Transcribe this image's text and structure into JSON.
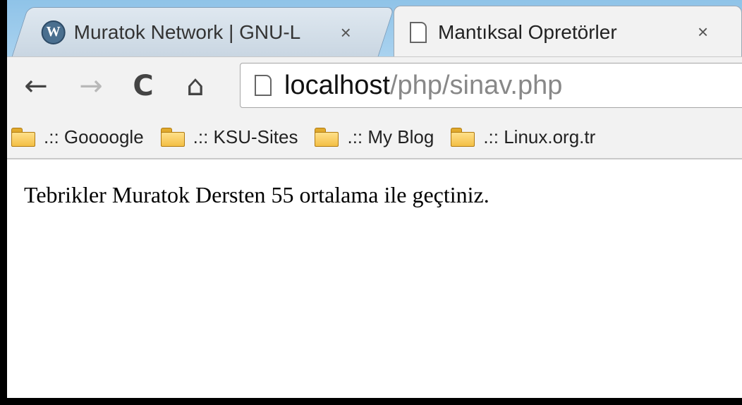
{
  "tabs": [
    {
      "title": "Muratok Network | GNU-L",
      "close": "×",
      "icon": "wordpress-icon",
      "active": false
    },
    {
      "title": "Mantıksal Opretörler",
      "close": "×",
      "icon": "page-icon",
      "active": true
    }
  ],
  "toolbar": {
    "back": "←",
    "forward": "→",
    "reload": "C",
    "home": "⌂",
    "url_host": "localhost",
    "url_path": "/php/sinav.php"
  },
  "bookmarks": [
    {
      "label": ".:: Goooogle",
      "icon": "folder-icon"
    },
    {
      "label": ".:: KSU-Sites",
      "icon": "folder-icon"
    },
    {
      "label": ".:: My Blog",
      "icon": "folder-icon"
    },
    {
      "label": ".:: Linux.org.tr",
      "icon": "folder-icon"
    }
  ],
  "page": {
    "message": "Tebrikler Muratok Dersten 55 ortalama ile geçtiniz."
  },
  "colors": {
    "tabstrip": "#a9d2ef",
    "toolbar": "#f2f2f2",
    "frame": "#000000"
  }
}
